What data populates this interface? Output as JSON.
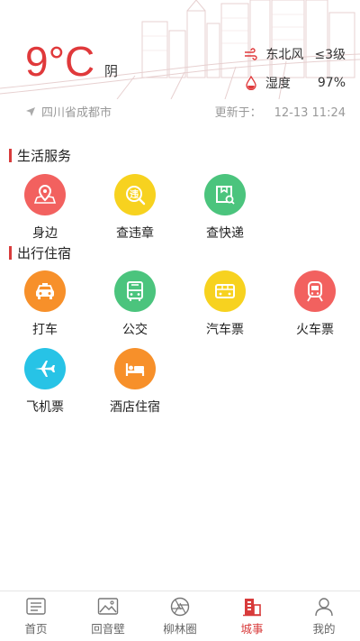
{
  "weather": {
    "temperature": "9°C",
    "condition": "阴",
    "wind_direction": "东北风",
    "wind_level": "≤3级",
    "humidity_label": "湿度",
    "humidity_value": "97%",
    "location": "四川省成都市",
    "update_label": "更新于：",
    "update_time": "12-13 11:24"
  },
  "sections": {
    "life": {
      "title": "生活服务",
      "items": [
        {
          "label": "身边",
          "icon": "map-pin-icon",
          "color": "#f2615f"
        },
        {
          "label": "查违章",
          "icon": "violation-search-icon",
          "color": "#f7d21f"
        },
        {
          "label": "查快递",
          "icon": "parcel-search-icon",
          "color": "#4bc47d"
        }
      ]
    },
    "travel": {
      "title": "出行住宿",
      "items": [
        {
          "label": "打车",
          "icon": "taxi-icon",
          "color": "#f7902a"
        },
        {
          "label": "公交",
          "icon": "bus-icon",
          "color": "#4bc47d"
        },
        {
          "label": "汽车票",
          "icon": "coach-ticket-icon",
          "color": "#f7d21f"
        },
        {
          "label": "火车票",
          "icon": "train-icon",
          "color": "#f2615f"
        },
        {
          "label": "飞机票",
          "icon": "airplane-icon",
          "color": "#27c3e6"
        },
        {
          "label": "酒店住宿",
          "icon": "hotel-bed-icon",
          "color": "#f7902a"
        }
      ]
    }
  },
  "tabs": [
    {
      "label": "首页",
      "icon": "news-icon",
      "active": false
    },
    {
      "label": "回音壁",
      "icon": "picture-icon",
      "active": false
    },
    {
      "label": "柳林圈",
      "icon": "aperture-icon",
      "active": false
    },
    {
      "label": "城事",
      "icon": "city-building-icon",
      "active": true
    },
    {
      "label": "我的",
      "icon": "user-icon",
      "active": false
    }
  ],
  "colors": {
    "accent": "#d83b3b",
    "temperature": "#e0393b"
  }
}
